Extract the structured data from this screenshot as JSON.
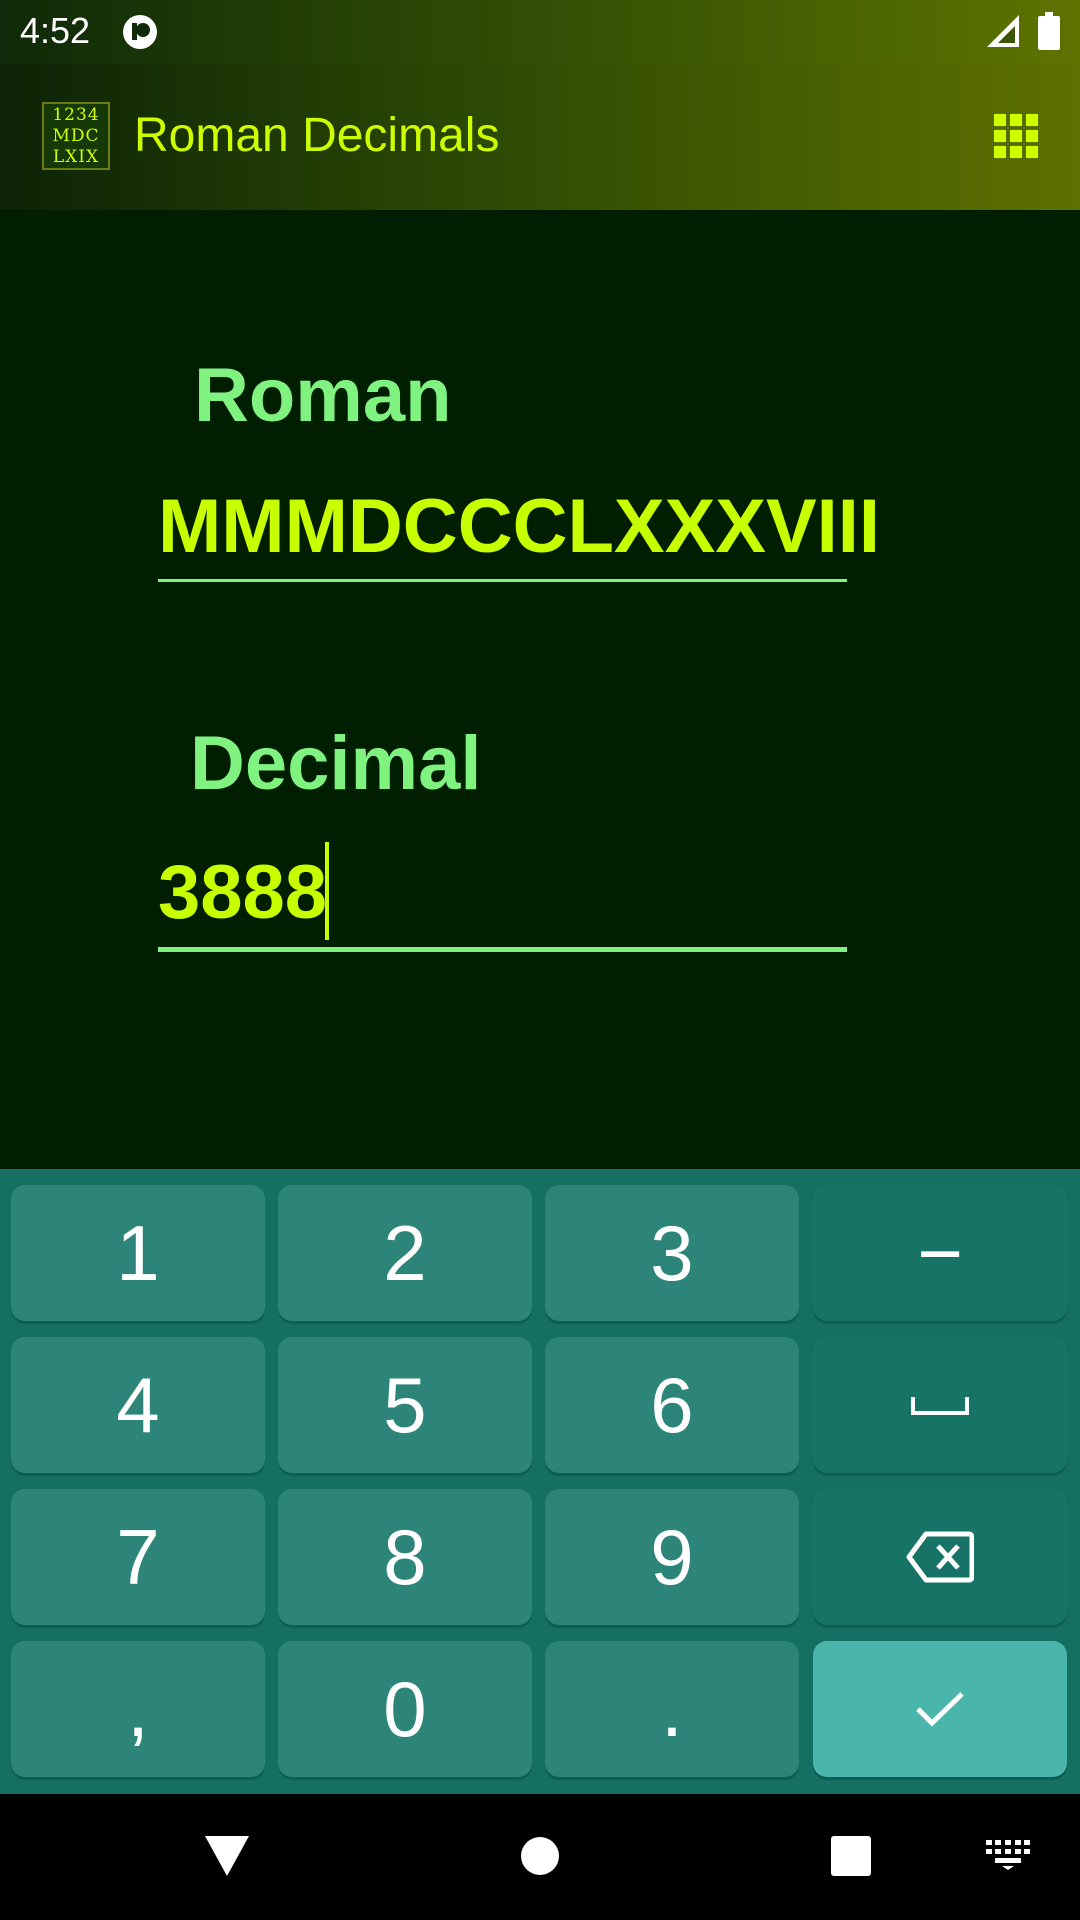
{
  "status_bar": {
    "time": "4:52"
  },
  "app_bar": {
    "title": "Roman Decimals",
    "logo_lines": [
      "1234",
      "MDC",
      "LXIX"
    ]
  },
  "form": {
    "roman_label": "Roman",
    "roman_value": "MMMDCCCLXXXVIII",
    "decimal_label": "Decimal",
    "decimal_value": "3888"
  },
  "keyboard": {
    "keys": [
      "1",
      "2",
      "3",
      "−",
      "4",
      "5",
      "6",
      "",
      "7",
      "8",
      "9",
      "",
      ",",
      "0",
      ".",
      ""
    ]
  },
  "colors": {
    "background": "#001f00",
    "accent": "#c8ff00",
    "label": "#7ff280",
    "keyboard": "#166f63",
    "key": "#2d857a",
    "enter_key": "#4ab6ab"
  },
  "icons": {
    "status": [
      "badge-icon",
      "signal-icon",
      "battery-icon"
    ],
    "app_bar": [
      "app-logo",
      "grid-icon"
    ],
    "keyboard": [
      "space-icon",
      "backspace-icon",
      "check-icon"
    ],
    "nav": [
      "back-icon",
      "home-icon",
      "recents-icon",
      "keyboard-icon"
    ]
  }
}
